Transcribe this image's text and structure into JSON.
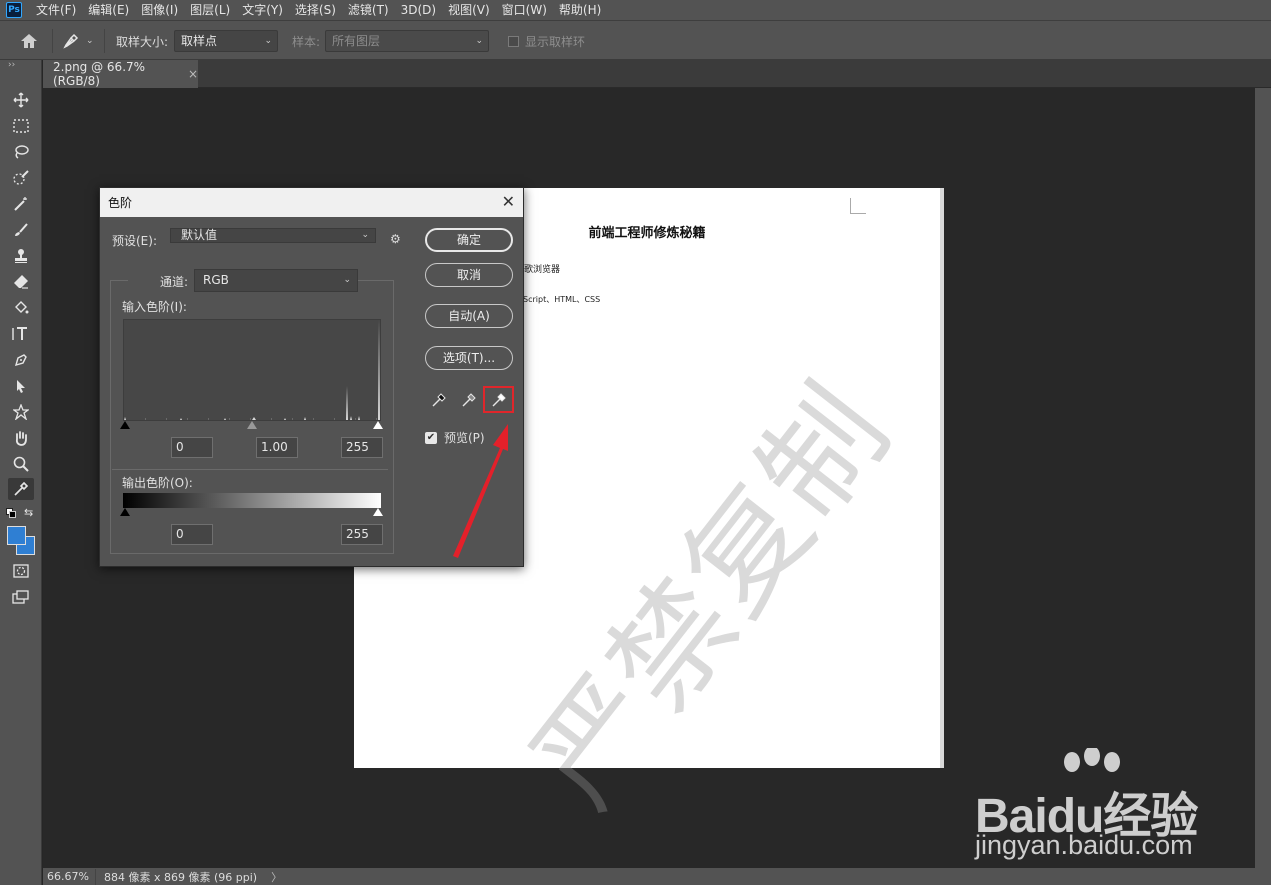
{
  "app": {
    "logo_text": "Ps"
  },
  "menu": [
    "文件(F)",
    "编辑(E)",
    "图像(I)",
    "图层(L)",
    "文字(Y)",
    "选择(S)",
    "滤镜(T)",
    "3D(D)",
    "视图(V)",
    "窗口(W)",
    "帮助(H)"
  ],
  "options_bar": {
    "sample_size_label": "取样大小:",
    "sample_size_value": "取样点",
    "sample_label": "样本:",
    "sample_value": "所有图层",
    "show_ring_label": "显示取样环"
  },
  "tab": {
    "title": "2.png @ 66.7%(RGB/8)",
    "close": "×"
  },
  "status": {
    "zoom": "66.67%",
    "info": "884 像素 x 869 像素 (96 ppi)",
    "arrow": "〉"
  },
  "document": {
    "title": "前端工程师修炼秘籍",
    "line1": "歌浏览器",
    "line2": "Script、HTML、CSS",
    "watermark": "严禁复制"
  },
  "levels": {
    "title": "色阶",
    "close": "✕",
    "preset_label": "预设(E):",
    "preset_value": "默认值",
    "channel_label": "通道:",
    "channel_value": "RGB",
    "input_label": "输入色阶(I):",
    "input_black": "0",
    "input_gamma": "1.00",
    "input_white": "255",
    "output_label": "输出色阶(O):",
    "output_black": "0",
    "output_white": "255",
    "btn_ok": "确定",
    "btn_cancel": "取消",
    "btn_auto": "自动(A)",
    "btn_options": "选项(T)...",
    "preview_label": "预览(P)",
    "preview_checked": true
  },
  "baidu": {
    "brand": "Baidu经验",
    "url": "jingyan.baidu.com"
  },
  "colors": {
    "foreground": "#2f7fd3",
    "background": "#2f7fd3",
    "highlight_red": "#e0262b"
  }
}
